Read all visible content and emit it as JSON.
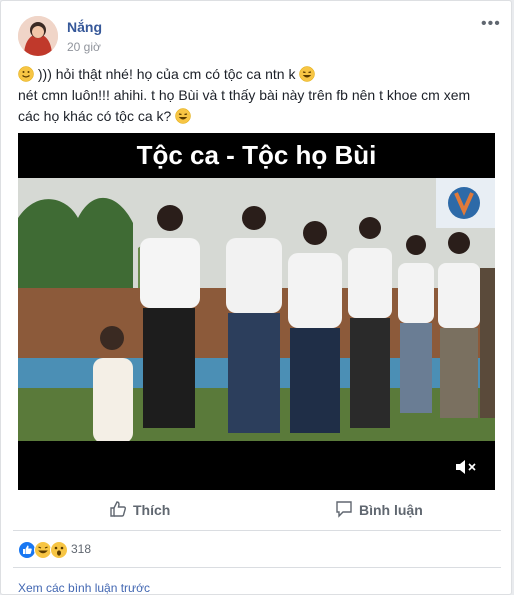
{
  "post": {
    "author": "Nắng",
    "time": "20 giờ",
    "line1": ")))  hỏi thật nhé! họ của cm có tộc ca ntn k",
    "line2": "nét cmn luôn!!! ahihi. t họ Bùi và t thấy bài này trên fb nên t khoe cm xem",
    "line3": "các họ khác có tộc ca k?"
  },
  "video": {
    "title": "Tộc ca - Tộc họ Bùi"
  },
  "actions": {
    "like_label": "Thích",
    "comment_label": "Bình luận"
  },
  "reactions": {
    "count": "318",
    "icons": [
      "like-icon",
      "haha-icon",
      "wow-icon"
    ]
  },
  "comments": {
    "previous_label": "Xem các bình luận trước"
  },
  "icons": {
    "more": "more-options-icon",
    "mute": "mute-icon",
    "smile": "smile-emoji-icon",
    "laugh": "laugh-emoji-icon"
  }
}
